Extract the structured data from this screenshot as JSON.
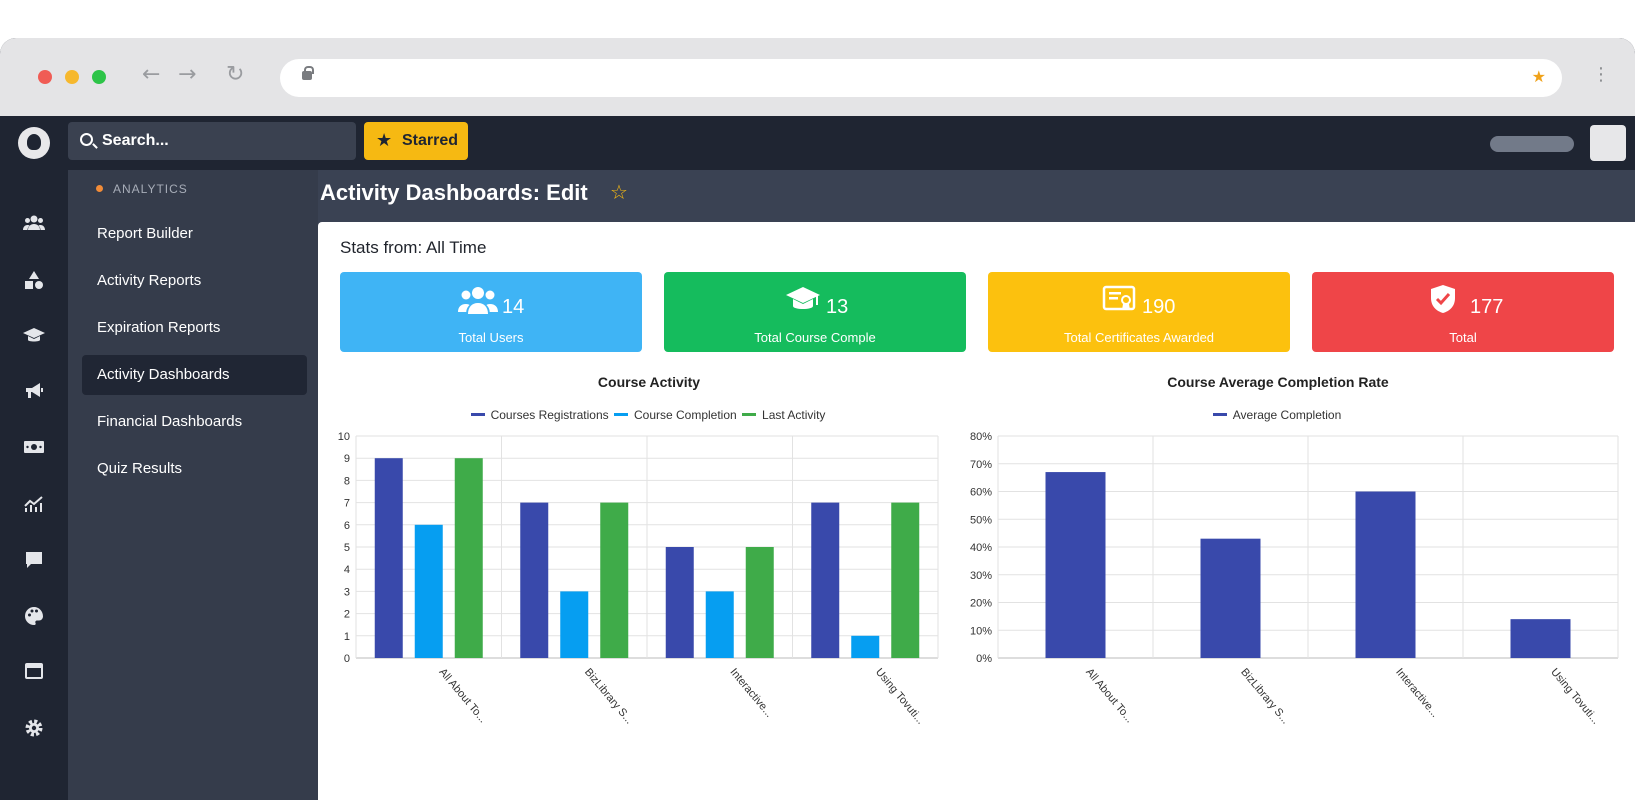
{
  "topbar": {
    "search_label": "Search...",
    "starred_label": "Starred"
  },
  "sidebar": {
    "section": "ANALYTICS",
    "items": [
      {
        "label": "Report Builder"
      },
      {
        "label": "Activity Reports"
      },
      {
        "label": "Expiration Reports"
      },
      {
        "label": "Activity Dashboards",
        "active": true
      },
      {
        "label": "Financial Dashboards"
      },
      {
        "label": "Quiz Results"
      }
    ]
  },
  "rail_icons": [
    "users-icon",
    "shapes-icon",
    "graduation-cap-icon",
    "megaphone-icon",
    "money-icon",
    "line-chart-icon",
    "chat-icon",
    "palette-icon",
    "window-icon",
    "gear-icon"
  ],
  "page": {
    "title": "Activity Dashboards: Edit",
    "stats_label": "Stats from: All Time"
  },
  "cards": [
    {
      "value": "14",
      "label": "Total Users",
      "color": "#3fb4f5",
      "icon": "users-icon"
    },
    {
      "value": "13",
      "label": "Total Course Comple",
      "color": "#15bc5d",
      "icon": "graduation-cap-icon"
    },
    {
      "value": "190",
      "label": "Total Certificates Awarded",
      "color": "#fcc10e",
      "icon": "certificate-icon"
    },
    {
      "value": "177",
      "label": "Total",
      "color": "#ef4548",
      "icon": "shield-check-icon"
    }
  ],
  "chart_data": [
    {
      "type": "bar",
      "title": "Course Activity",
      "categories": [
        "All About To...",
        "BizLibrary S...",
        "Interactive...",
        "Using Tovuti..."
      ],
      "series": [
        {
          "name": "Courses Registrations",
          "color": "#3949ab",
          "values": [
            9,
            7,
            5,
            7
          ]
        },
        {
          "name": "Course Completion",
          "color": "#069ef1",
          "values": [
            6,
            3,
            3,
            1
          ]
        },
        {
          "name": "Last Activity",
          "color": "#3fab49",
          "values": [
            9,
            7,
            5,
            7
          ]
        }
      ],
      "ylim": [
        0,
        10
      ],
      "yticks": [
        "0",
        "1",
        "2",
        "3",
        "4",
        "5",
        "6",
        "7",
        "8",
        "9",
        "10"
      ],
      "grid": true,
      "legend": "top-center"
    },
    {
      "type": "bar",
      "title": "Course Average Completion Rate",
      "categories": [
        "All About To...",
        "BizLibrary S...",
        "Interactive...",
        "Using Tovuti..."
      ],
      "series": [
        {
          "name": "Average Completion",
          "color": "#3949ab",
          "values": [
            67,
            43,
            60,
            14
          ]
        }
      ],
      "ylim": [
        0,
        80
      ],
      "yticks": [
        "0%",
        "10%",
        "20%",
        "30%",
        "40%",
        "50%",
        "60%",
        "70%",
        "80%"
      ],
      "grid": true,
      "legend": "top-center"
    }
  ]
}
